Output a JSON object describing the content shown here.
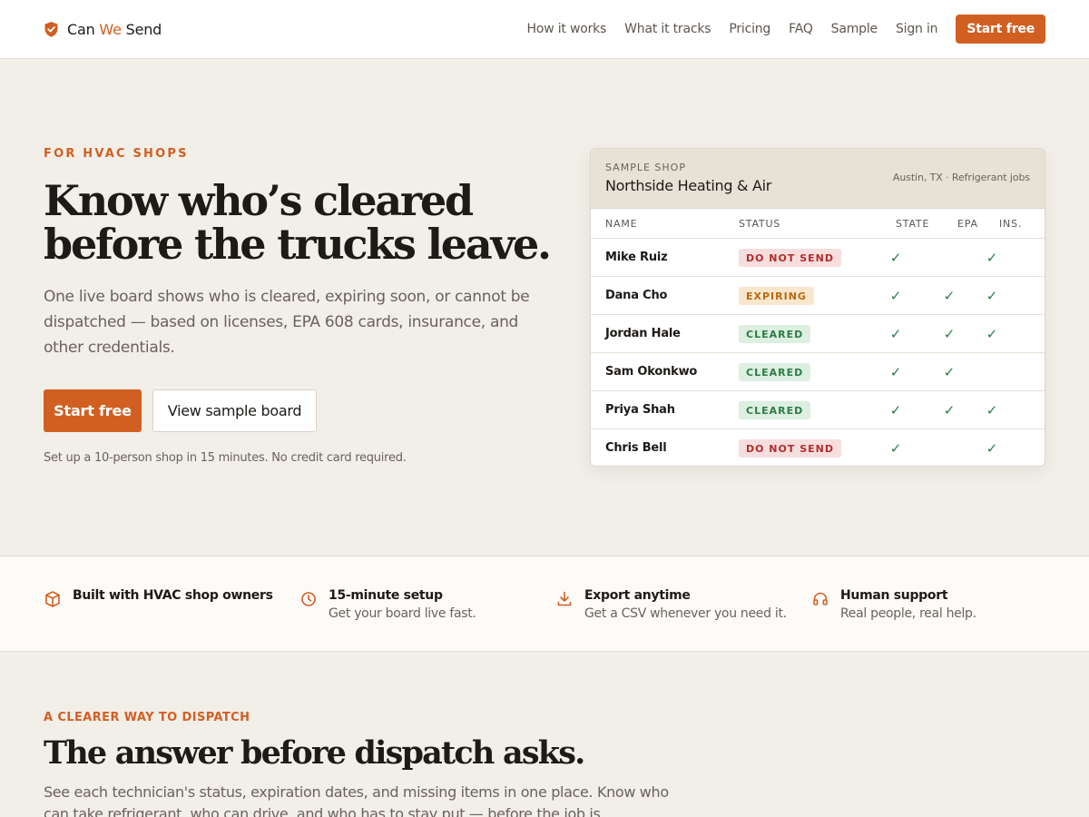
{
  "colors": {
    "accent": "#d25f22",
    "background": "#f2eee8",
    "status_red": "#b32c2c",
    "status_amber": "#b86a12",
    "status_green": "#2b7c45"
  },
  "header": {
    "brand": {
      "part1": "Can ",
      "part2": "We",
      "part3": " Send",
      "icon": "shield-check-icon"
    },
    "nav": [
      "How it works",
      "What it tracks",
      "Pricing",
      "FAQ",
      "Sample",
      "Sign in"
    ],
    "cta": "Start free"
  },
  "hero": {
    "eyebrow": "FOR HVAC SHOPS",
    "title": "Know who’s cleared before the trucks leave.",
    "subtitle": "One live board shows who is cleared, expiring soon, or cannot be dispatched — based on licenses, EPA 608 cards, insurance, and other credentials.",
    "primary_button": "Start free",
    "secondary_button": "View sample board",
    "note": "Set up a 10-person shop in 15 minutes. No credit card required."
  },
  "board": {
    "label": "SAMPLE SHOP",
    "shop": "Northside Heating & Air",
    "meta": "Austin, TX · Refrigerant jobs",
    "columns": [
      "NAME",
      "STATUS",
      "STATE",
      "EPA",
      "INS."
    ],
    "check_glyph": "✓",
    "rows": [
      {
        "name": "Mike Ruiz",
        "status": "DO NOT SEND",
        "tone": "red",
        "state": true,
        "epa": false,
        "ins": true
      },
      {
        "name": "Dana Cho",
        "status": "EXPIRING",
        "tone": "amber",
        "state": true,
        "epa": true,
        "ins": true
      },
      {
        "name": "Jordan Hale",
        "status": "CLEARED",
        "tone": "green",
        "state": true,
        "epa": true,
        "ins": true
      },
      {
        "name": "Sam Okonkwo",
        "status": "CLEARED",
        "tone": "green",
        "state": true,
        "epa": true,
        "ins": false
      },
      {
        "name": "Priya Shah",
        "status": "CLEARED",
        "tone": "green",
        "state": true,
        "epa": true,
        "ins": true
      },
      {
        "name": "Chris Bell",
        "status": "DO NOT SEND",
        "tone": "red",
        "state": true,
        "epa": false,
        "ins": true
      }
    ]
  },
  "features": [
    {
      "icon": "box-icon",
      "title": "Built with HVAC shop owners",
      "desc": ""
    },
    {
      "icon": "clock-icon",
      "title": "15-minute setup",
      "desc": "Get your board live fast."
    },
    {
      "icon": "download-icon",
      "title": "Export anytime",
      "desc": "Get a CSV whenever you need it."
    },
    {
      "icon": "headset-icon",
      "title": "Human support",
      "desc": "Real people, real help."
    }
  ],
  "section2": {
    "eyebrow": "A CLEARER WAY TO DISPATCH",
    "title": "The answer before dispatch asks.",
    "subtitle": "See each technician's status, expiration dates, and missing items in one place. Know who can take refrigerant, who can drive, and who has to stay put — before the job is assigned."
  }
}
